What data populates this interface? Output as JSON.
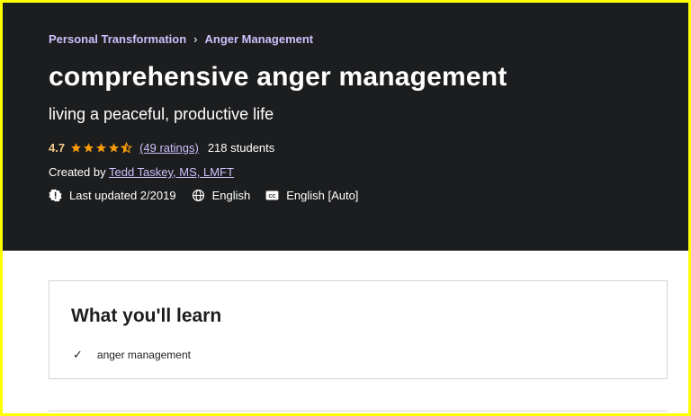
{
  "breadcrumb": {
    "items": [
      "Personal Transformation",
      "Anger Management"
    ],
    "separator_icon": "chevron-right-icon"
  },
  "course": {
    "title": "comprehensive anger management",
    "subtitle": "living a peaceful, productive life",
    "rating": "4.7",
    "rating_stars": 4.7,
    "ratings_count": "(49 ratings)",
    "students": "218 students",
    "created_by_label": "Created by",
    "instructor": "Tedd Taskey, MS, LMFT",
    "last_updated": "Last updated 2/2019",
    "language": "English",
    "captions": "English [Auto]"
  },
  "learn": {
    "heading": "What you'll learn",
    "items": [
      "anger management"
    ]
  },
  "colors": {
    "hero_bg": "#1c1d1f",
    "accent_link": "#cec0fc",
    "star": "#f69c08",
    "frame": "#ffff00"
  }
}
